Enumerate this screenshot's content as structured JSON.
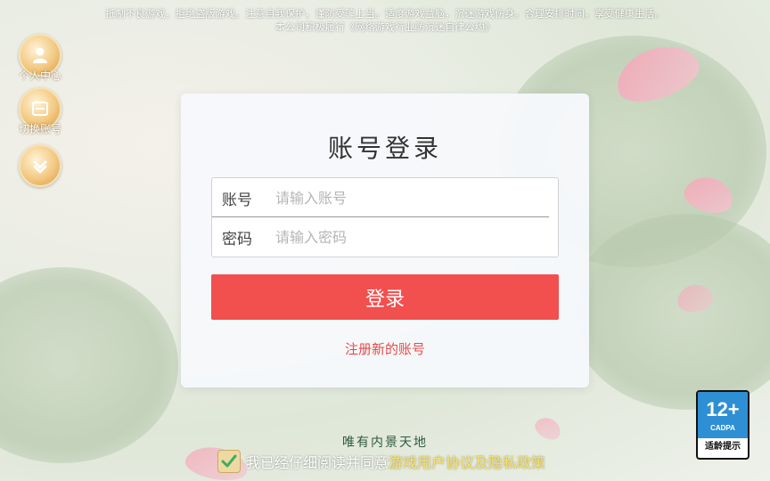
{
  "notice": {
    "line1": "抵制不良游戏，拒绝盗版游戏。注意自我保护，谨防受骗上当。适度游戏益脑，沉迷游戏伤身。合理安排时间，享受健康生活。",
    "line2": "本公司积极履行《网络游戏行业防沉迷自律公约》"
  },
  "side": {
    "user_center": "个人中心",
    "switch_account": "切换账号",
    "collapse_icon": "chevron-down-icon"
  },
  "login": {
    "title": "账号登录",
    "account_label": "账号",
    "account_placeholder": "请输入账号",
    "password_label": "密码",
    "password_placeholder": "请输入密码",
    "submit": "登录",
    "register": "注册新的账号"
  },
  "footer": {
    "slogan": "唯有内景天地",
    "agree_prefix": "我已经仔细阅读并同意",
    "agree_link": "游戏用户协议及隐私政策",
    "agree_checked": true
  },
  "age_rating": {
    "age": "12+",
    "org": "CADPA",
    "label": "适龄提示",
    "color": "#2e8fd4"
  },
  "colors": {
    "primary": "#f24f4f",
    "link": "#e94a4a",
    "agree_link": "#f5e36b"
  }
}
